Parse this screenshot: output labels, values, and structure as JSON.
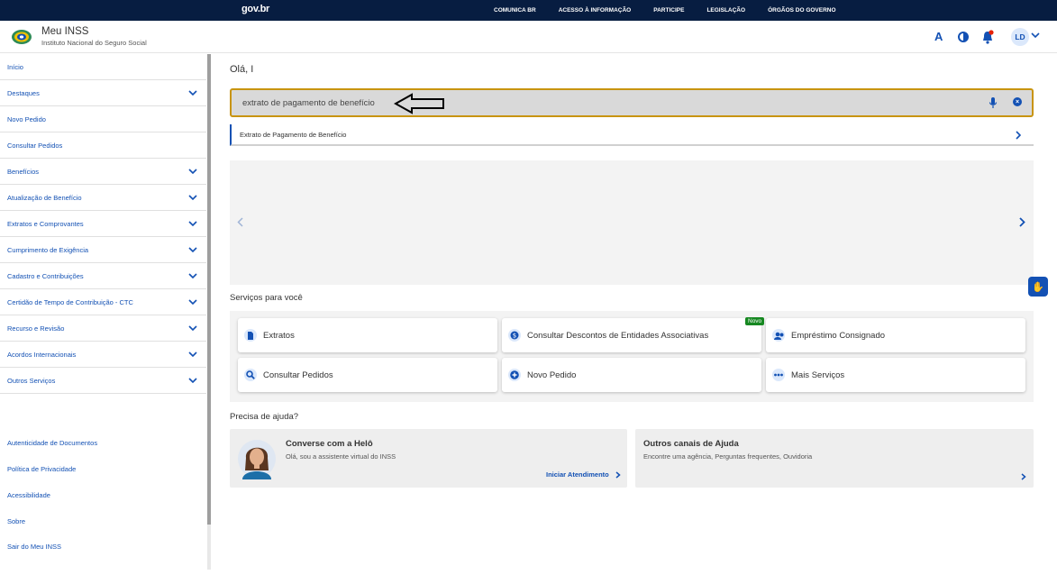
{
  "govbar": {
    "logo": "gov.br",
    "links": [
      "COMUNICA BR",
      "ACESSO À INFORMAÇÃO",
      "PARTICIPE",
      "LEGISLAÇÃO",
      "ÓRGÃOS DO GOVERNO"
    ]
  },
  "header": {
    "title": "Meu INSS",
    "subtitle": "Instituto Nacional do Seguro Social",
    "font_icon": "A",
    "avatar_initials": "LD"
  },
  "sidebar": {
    "items": [
      {
        "label": "Início",
        "expandable": false
      },
      {
        "label": "Destaques",
        "expandable": true
      },
      {
        "label": "Novo Pedido",
        "expandable": false
      },
      {
        "label": "Consultar Pedidos",
        "expandable": false
      },
      {
        "label": "Benefícios",
        "expandable": true
      },
      {
        "label": "Atualização de Benefício",
        "expandable": true
      },
      {
        "label": "Extratos e Comprovantes",
        "expandable": true
      },
      {
        "label": "Cumprimento de Exigência",
        "expandable": true
      },
      {
        "label": "Cadastro e Contribuições",
        "expandable": true
      },
      {
        "label": "Certidão de Tempo de Contribuição - CTC",
        "expandable": true
      },
      {
        "label": "Recurso e Revisão",
        "expandable": true
      },
      {
        "label": "Acordos Internacionais",
        "expandable": true
      },
      {
        "label": "Outros Serviços",
        "expandable": true
      }
    ],
    "footer_links": [
      "Autenticidade de Documentos",
      "Política de Privacidade",
      "Acessibilidade",
      "Sobre",
      "Sair do Meu INSS"
    ]
  },
  "main": {
    "greeting": "Olá, I",
    "search_value": "extrato de pagamento de benefício",
    "suggestion": "Extrato de Pagamento de Benefício",
    "services_title": "Serviços para você",
    "new_badge": "Novo",
    "services": [
      {
        "label": "Extratos",
        "icon": "document-icon"
      },
      {
        "label": "Consultar Descontos de Entidades Associativas",
        "icon": "money-icon"
      },
      {
        "label": "Empréstimo Consignado",
        "icon": "people-icon"
      },
      {
        "label": "Consultar Pedidos",
        "icon": "search-icon"
      },
      {
        "label": "Novo Pedido",
        "icon": "plus-icon"
      },
      {
        "label": "Mais Serviços",
        "icon": "more-icon"
      }
    ],
    "help_title": "Precisa de ajuda?",
    "helo": {
      "title": "Converse com a Helô",
      "subtitle": "Olá, sou a assistente virtual do INSS",
      "link": "Iniciar Atendimento"
    },
    "channels": {
      "title": "Outros canais de Ajuda",
      "subtitle": "Encontre uma agência, Perguntas frequentes, Ouvidoria"
    }
  },
  "colors": {
    "gov_blue": "#071d41",
    "primary": "#1351b4",
    "search_border": "#c8940f",
    "badge_green": "#168821"
  }
}
